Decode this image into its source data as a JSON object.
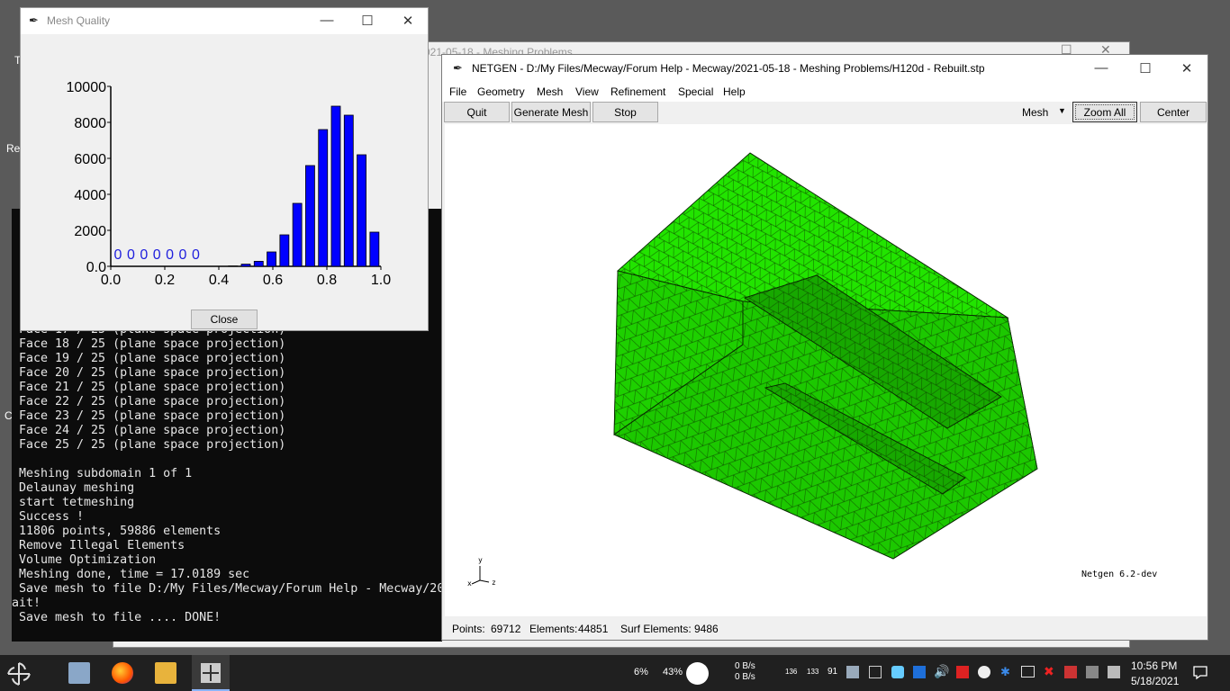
{
  "background_window": {
    "title_fragment": "021-05-18 - Meshing Problems",
    "left_edge_chars": [
      "T",
      "Re",
      "C"
    ]
  },
  "console": {
    "lines": [
      "Face 17 / 25 (plane space projection)",
      "Face 18 / 25 (plane space projection)",
      "Face 19 / 25 (plane space projection)",
      "Face 20 / 25 (plane space projection)",
      "Face 21 / 25 (plane space projection)",
      "Face 22 / 25 (plane space projection)",
      "Face 23 / 25 (plane space projection)",
      "Face 24 / 25 (plane space projection)",
      "Face 25 / 25 (plane space projection)",
      "",
      "Meshing subdomain 1 of 1",
      "Delaunay meshing",
      "start tetmeshing",
      "Success !",
      "11806 points, 59886 elements",
      "Remove Illegal Elements",
      "Volume Optimization",
      "Meshing done, time = 17.0189 sec",
      "Save mesh to file D:/My Files/Mecway/Forum Help - Mecway/20",
      "ait!",
      "Save mesh to file .... DONE!"
    ]
  },
  "mesh_quality": {
    "title": "Mesh Quality",
    "close_label": "Close",
    "chart_data": {
      "type": "bar",
      "title": "",
      "xlabel": "",
      "ylabel": "",
      "x_ticks": [
        "0.0",
        "0.2",
        "0.4",
        "0.6",
        "0.8",
        "1.0"
      ],
      "y_ticks": [
        "0.0",
        "2000",
        "4000",
        "6000",
        "8000",
        "10000"
      ],
      "xlim": [
        0,
        1
      ],
      "ylim": [
        0,
        10000
      ],
      "bin_width": 0.05,
      "bin_starts": [
        0.0,
        0.05,
        0.1,
        0.15,
        0.2,
        0.25,
        0.3,
        0.35,
        0.4,
        0.45,
        0.5,
        0.55,
        0.6,
        0.65,
        0.7,
        0.75,
        0.8,
        0.85,
        0.9,
        0.95
      ],
      "values": [
        0,
        0,
        0,
        0,
        0,
        0,
        0,
        0,
        0,
        20,
        120,
        280,
        800,
        1750,
        3500,
        5600,
        7600,
        8900,
        8400,
        6200,
        1900
      ],
      "zero_labels": [
        "0",
        "0",
        "0",
        "0",
        "0",
        "0",
        "0"
      ],
      "bar_color": "#0000ff"
    }
  },
  "netgen": {
    "title": "NETGEN - D:/My Files/Mecway/Forum Help - Mecway/2021-05-18 - Meshing Problems/H120d - Rebuilt.stp",
    "menu": [
      "File",
      "Geometry",
      "Mesh",
      "View",
      "Refinement",
      "Special",
      "Help"
    ],
    "toolbar": {
      "quit": "Quit",
      "generate_mesh": "Generate Mesh",
      "stop": "Stop",
      "view_select": "Mesh",
      "zoom_all": "Zoom All",
      "center": "Center"
    },
    "viewport": {
      "version_text": "Netgen 6.2-dev",
      "axis_y": "y",
      "axis_x": "x",
      "axis_z": "z",
      "mesh_color": "#22e400"
    },
    "status": {
      "points_label": "Points:",
      "points_value": "69712",
      "elements_label": "Elements:",
      "elements_value": "44851",
      "surf_label": "Surf Elements:",
      "surf_value": "9486"
    }
  },
  "taskbar": {
    "cpu": "6%",
    "mem": "43%",
    "net_up": "0 B/s",
    "net_down": "0 B/s",
    "tray_nums": [
      "136",
      "133",
      "91"
    ],
    "time": "10:56 PM",
    "date": "5/18/2021"
  }
}
